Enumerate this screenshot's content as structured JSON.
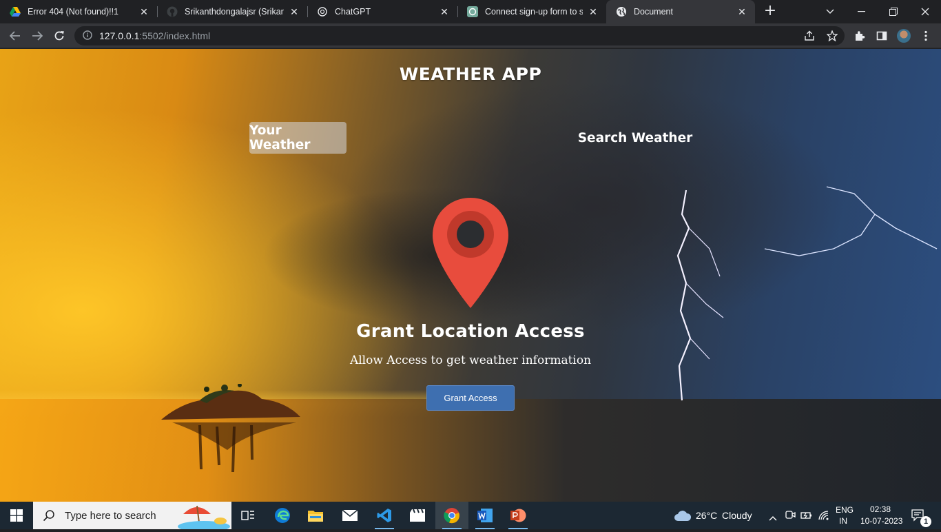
{
  "browser": {
    "tabs": [
      {
        "title": "Error 404 (Not found)!!1",
        "icon": "google-drive-icon",
        "active": false
      },
      {
        "title": "Srikanthdongalajsr (Srikanth",
        "icon": "github-icon",
        "active": false
      },
      {
        "title": "ChatGPT",
        "icon": "openai-icon",
        "active": false
      },
      {
        "title": "Connect sign-up form to ser",
        "icon": "openai-icon",
        "active": false
      },
      {
        "title": "Document",
        "icon": "globe-icon",
        "active": true
      }
    ],
    "url_host": "127.0.0.1",
    "url_rest": ":5502/index.html"
  },
  "page": {
    "app_title": "WEATHER APP",
    "tab_your_weather": "Your Weather",
    "tab_search_weather": "Search Weather",
    "grant_title": "Grant Location Access",
    "grant_subtitle": "Allow Access to get weather information",
    "grant_button": "Grant Access"
  },
  "taskbar": {
    "search_placeholder": "Type here to search",
    "weather_temp": "26°C",
    "weather_desc": "Cloudy",
    "lang_top": "ENG",
    "lang_bottom": "IN",
    "time": "02:38",
    "date": "10-07-2023",
    "notification_count": "1"
  },
  "colors": {
    "grant_button": "#3e6fb0",
    "pin_red": "#e84c3d",
    "pin_inner": "#c0392b",
    "taskbar": "#1c2833"
  }
}
